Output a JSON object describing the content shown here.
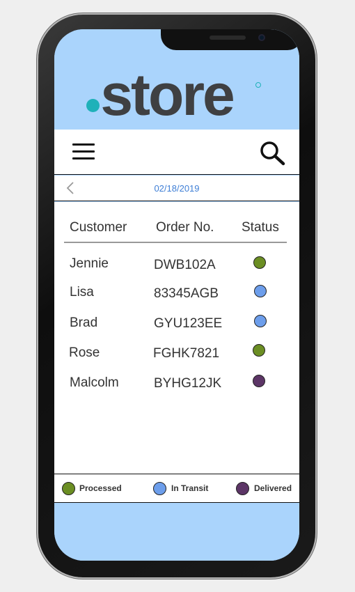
{
  "brand": {
    "logo_text": "store",
    "dot_color": "#1fb1b9"
  },
  "toolbar": {
    "menu_icon": "hamburger-menu-icon",
    "search_icon": "search-icon"
  },
  "date_bar": {
    "back_icon": "chevron-left-icon",
    "date": "02/18/2019"
  },
  "table": {
    "headers": [
      "Customer",
      "Order No.",
      "Status"
    ],
    "rows": [
      {
        "customer": "Jennie",
        "order_no": "DWB102A",
        "status": "Processed"
      },
      {
        "customer": "Lisa",
        "order_no": "83345AGB",
        "status": "In Transit"
      },
      {
        "customer": "Brad",
        "order_no": "GYU123EE",
        "status": "In Transit"
      },
      {
        "customer": "Rose",
        "order_no": "FGHK7821",
        "status": "Processed"
      },
      {
        "customer": "Malcolm",
        "order_no": "BYHG12JK",
        "status": "Delivered"
      }
    ]
  },
  "legend": [
    {
      "label": "Processed",
      "color": "#6b8e23"
    },
    {
      "label": "In Transit",
      "color": "#6d9eeb"
    },
    {
      "label": "Delivered",
      "color": "#5c3566"
    }
  ]
}
